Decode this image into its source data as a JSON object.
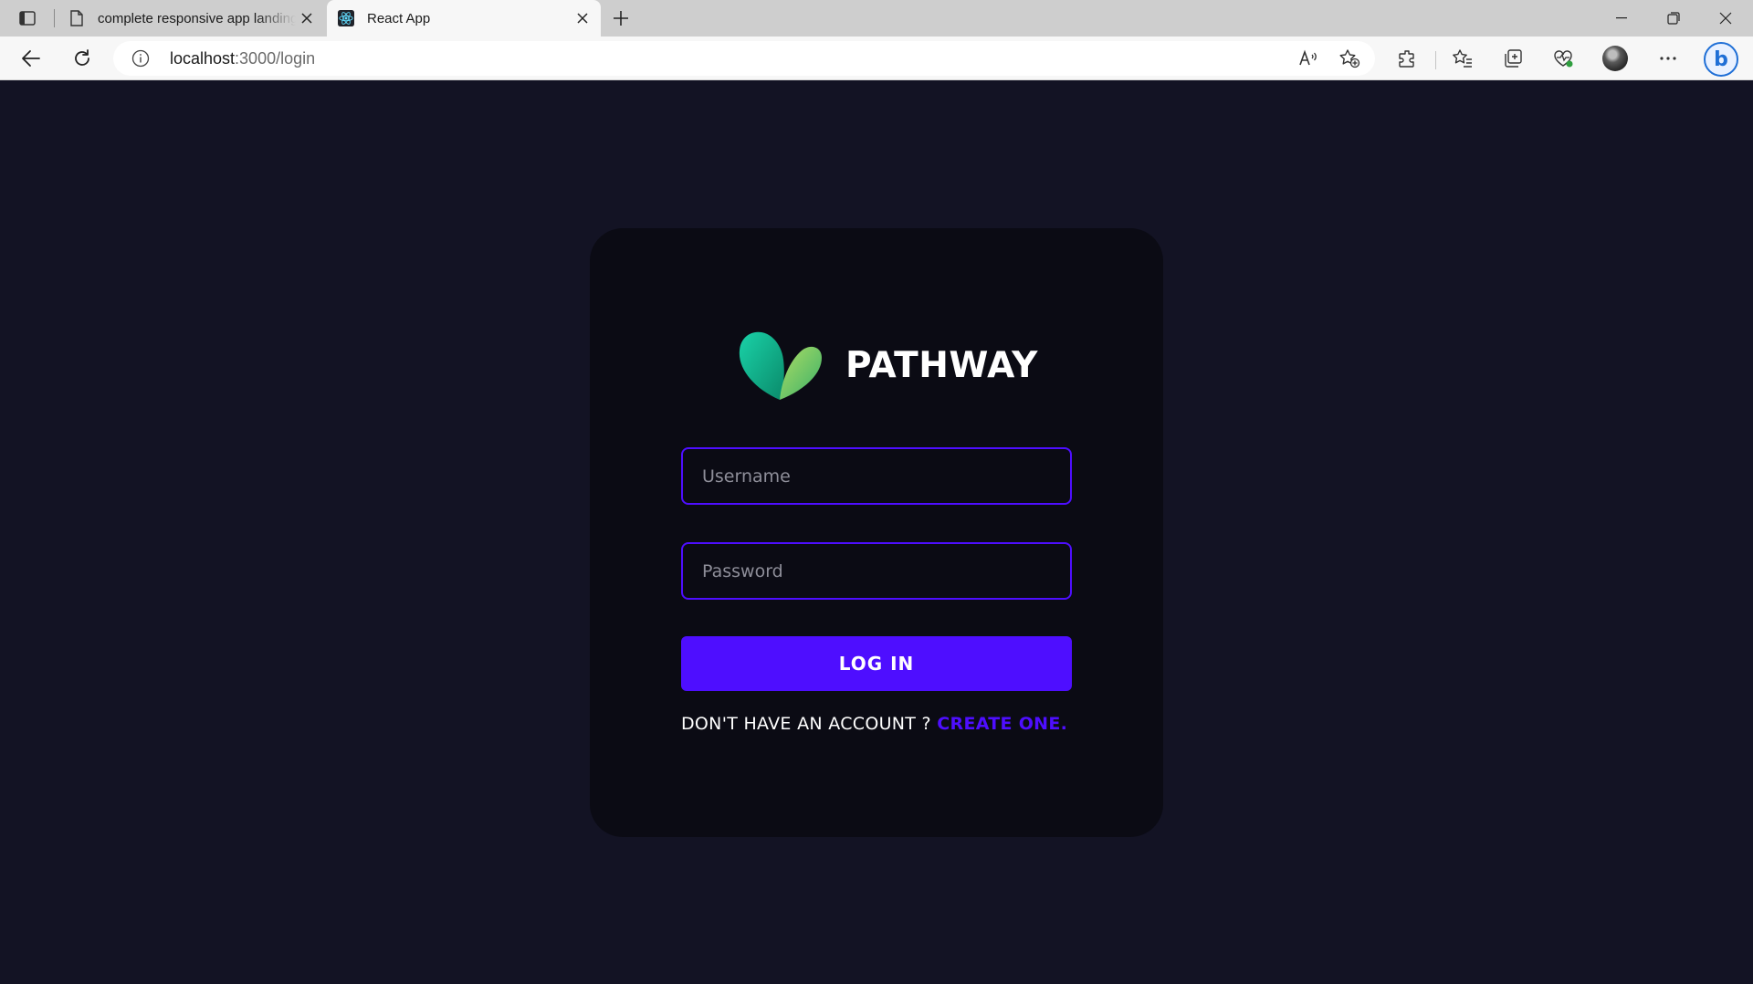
{
  "browser": {
    "tabs": [
      {
        "title": "complete responsive app landing page",
        "active": false
      },
      {
        "title": "React App",
        "active": true
      }
    ],
    "address": {
      "host": "localhost",
      "path": ":3000/login"
    }
  },
  "login": {
    "brand_name": "PATHWAY",
    "username_placeholder": "Username",
    "password_placeholder": "Password",
    "login_button": "LOG IN",
    "signup_prompt": "DON'T HAVE AN ACCOUNT ? ",
    "signup_link": "CREATE ONE."
  },
  "colors": {
    "page_background": "#131324",
    "card_background": "#0b0b14",
    "accent": "#4e0eff",
    "text": "#ffffff",
    "logo_gradient": [
      "#12c2a0",
      "#a8e063"
    ]
  },
  "icons": [
    "tab-actions-icon",
    "page-icon",
    "react-icon",
    "close-icon",
    "plus-icon",
    "minimize-icon",
    "restore-icon",
    "back-icon",
    "refresh-icon",
    "info-icon",
    "read-aloud-icon",
    "add-favorite-icon",
    "extensions-icon",
    "favorites-icon",
    "collections-icon",
    "browser-essentials-icon",
    "more-icon",
    "bing-icon",
    "pathway-logo-icon"
  ]
}
